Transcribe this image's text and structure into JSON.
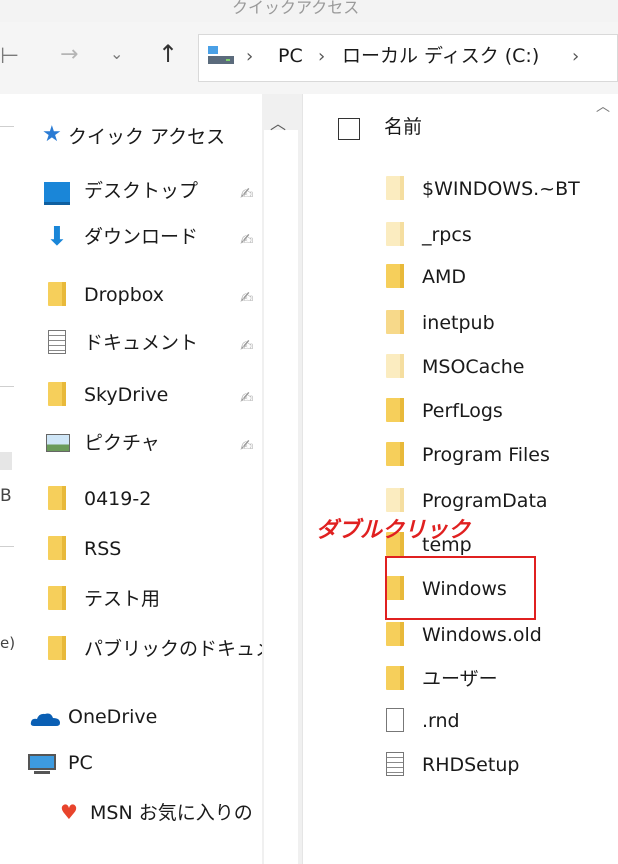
{
  "window": {
    "title_fragment": "クイックアクセス"
  },
  "address": {
    "path": [
      "PC",
      "ローカル ディスク (C:)"
    ],
    "separator": "›"
  },
  "nav": {
    "quick_access_label": "クイック アクセス",
    "items": [
      {
        "label": "デスクトップ",
        "icon": "desktop-icon",
        "pinned": true
      },
      {
        "label": "ダウンロード",
        "icon": "download-arrow-icon",
        "pinned": true
      },
      {
        "label": "Dropbox",
        "icon": "folder-icon",
        "pinned": true
      },
      {
        "label": "ドキュメント",
        "icon": "document-icon",
        "pinned": true
      },
      {
        "label": "SkyDrive",
        "icon": "folder-icon",
        "pinned": true
      },
      {
        "label": "ピクチャ",
        "icon": "pictures-icon",
        "pinned": true
      },
      {
        "label": "0419-2",
        "icon": "folder-icon",
        "pinned": false
      },
      {
        "label": "RSS",
        "icon": "folder-icon",
        "pinned": false
      },
      {
        "label": "テスト用",
        "icon": "folder-icon",
        "pinned": false
      },
      {
        "label": "パブリックのドキュメ",
        "icon": "folder-icon",
        "pinned": false
      }
    ],
    "onedrive_label": "OneDrive",
    "pc_label": "PC",
    "msn_label": "MSN お気に入りの",
    "left_fragments": [
      "B",
      "e)"
    ]
  },
  "content": {
    "header_name": "名前",
    "files": [
      {
        "name": "$WINDOWS.~BT",
        "kind": "folder-faint"
      },
      {
        "name": "_rpcs",
        "kind": "folder-faint"
      },
      {
        "name": "AMD",
        "kind": "folder"
      },
      {
        "name": "inetpub",
        "kind": "folder"
      },
      {
        "name": "MSOCache",
        "kind": "folder-faint"
      },
      {
        "name": "PerfLogs",
        "kind": "folder"
      },
      {
        "name": "Program Files",
        "kind": "folder"
      },
      {
        "name": "ProgramData",
        "kind": "folder-faint"
      },
      {
        "name": "temp",
        "kind": "folder"
      },
      {
        "name": "Windows",
        "kind": "folder"
      },
      {
        "name": "Windows.old",
        "kind": "folder"
      },
      {
        "name": "ユーザー",
        "kind": "folder"
      },
      {
        "name": ".rnd",
        "kind": "file"
      },
      {
        "name": "RHDSetup",
        "kind": "file-text"
      }
    ]
  },
  "annotation": {
    "text": "ダブルクリック",
    "color": "#e02020"
  }
}
